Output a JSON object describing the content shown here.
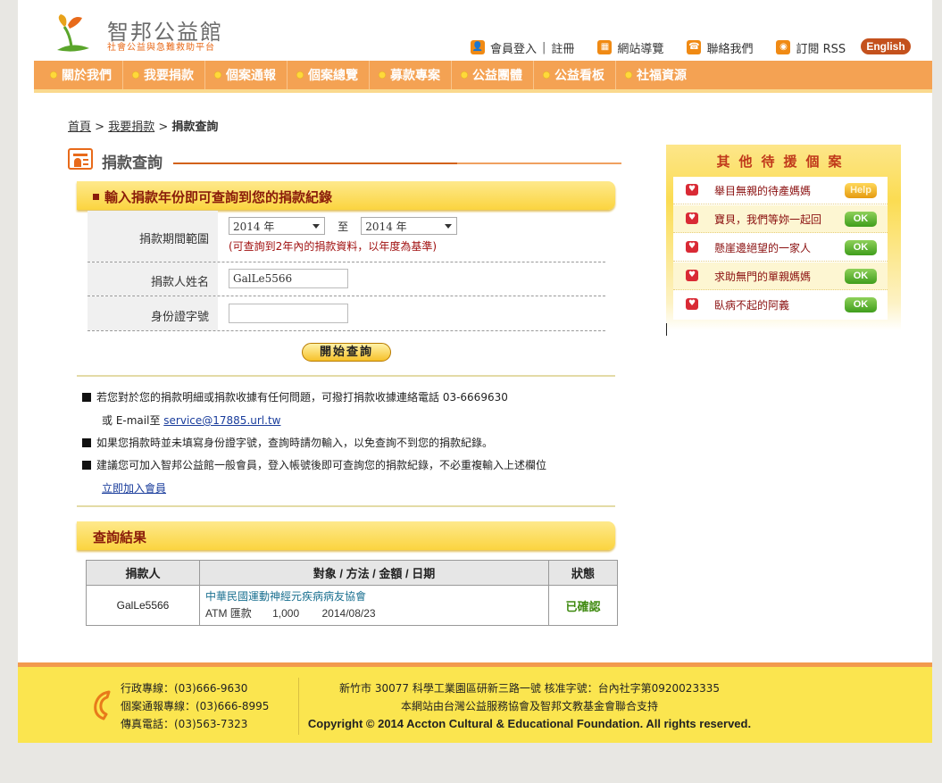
{
  "header": {
    "logo_title": "智邦公益館",
    "logo_sub": "社會公益與急難救助平台",
    "login": "會員登入",
    "register": "註冊",
    "sitemap": "網站導覽",
    "contact": "聯絡我們",
    "rss": "訂閱 RSS",
    "english": "English"
  },
  "nav": [
    "關於我們",
    "我要捐款",
    "個案通報",
    "個案總覽",
    "募款專案",
    "公益團體",
    "公益看板",
    "社福資源"
  ],
  "breadcrumb": {
    "home": "首頁",
    "parent": "我要捐款",
    "current": "捐款查詢"
  },
  "section_title": "捐款查詢",
  "form": {
    "heading": "輸入捐款年份即可查詢到您的捐款紀錄",
    "period_label": "捐款期間範圍",
    "year_from": "2014 年",
    "to": "至",
    "year_to": "2014 年",
    "period_hint": "(可查詢到2年內的捐款資料，以年度為基準)",
    "name_label": "捐款人姓名",
    "name_value": "GalLe5566",
    "id_label": "身份證字號",
    "id_value": "",
    "submit": "開始查詢"
  },
  "notes": {
    "n1": "若您對於您的捐款明細或捐款收據有任何問題，可撥打捐款收據連絡電話 03-6669630",
    "n1b_prefix": "或 E-mail至",
    "email": "service@17885.url.tw",
    "n2": "如果您捐款時並未填寫身份證字號，查詢時請勿輸入，以免查詢不到您的捐款紀錄。",
    "n3": "建議您可加入智邦公益館一般會員，登入帳號後即可查詢您的捐款紀錄，不必重複輸入上述欄位",
    "join": "立即加入會員"
  },
  "results": {
    "heading": "查詢結果",
    "columns": [
      "捐款人",
      "對象 / 方法 / 金額 / 日期",
      "狀態"
    ],
    "rows": [
      {
        "donor": "GalLe5566",
        "org": "中華民國運動神經元疾病病友協會",
        "method": "ATM 匯款",
        "amount": "1,000",
        "date": "2014/08/23",
        "status": "已確認"
      }
    ]
  },
  "sidebar": {
    "title": "其他待援個案",
    "items": [
      {
        "text": "舉目無親的待產媽媽",
        "badge": "Help"
      },
      {
        "text": "寶貝，我們等妳一起回",
        "badge": "OK"
      },
      {
        "text": "懸崖邊絕望的一家人",
        "badge": "OK"
      },
      {
        "text": "求助無門的單親媽媽",
        "badge": "OK"
      },
      {
        "text": "臥病不起的阿義",
        "badge": "OK"
      }
    ]
  },
  "footer": {
    "admin": "行政專線：(03)666-9630",
    "case": "個案通報專線：(03)666-8995",
    "fax": "傳真電話：(03)563-7323",
    "address": "新竹市 30077 科學工業園區研新三路一號 核准字號：台內社字第0920023335",
    "support": "本網站由台灣公益服務協會及智邦文教基金會聯合支持",
    "copyright": "Copyright © 2014 Accton Cultural & Educational Foundation. All rights reserved."
  },
  "colors": {
    "accent_orange": "#f4a253",
    "yellow": "#fbe54f",
    "title_red": "#8a1c0a",
    "ok_green": "#3f9d1c"
  }
}
